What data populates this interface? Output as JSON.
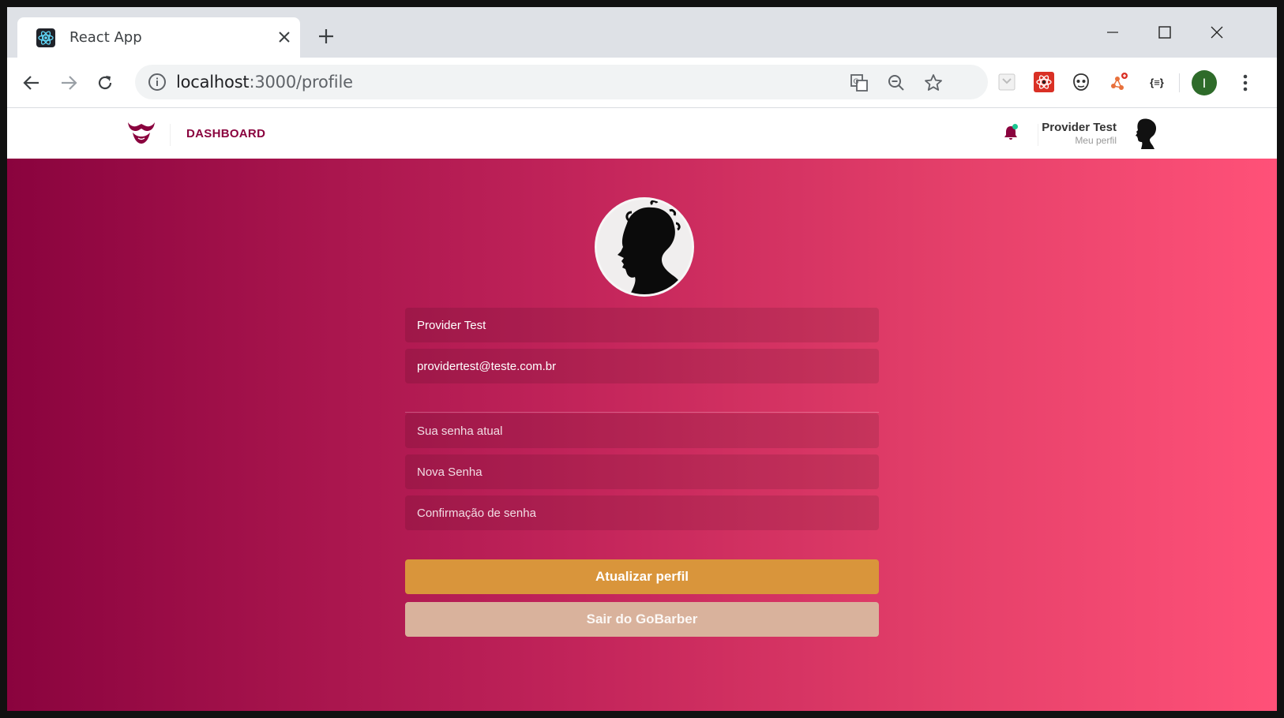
{
  "browser": {
    "tab_title": "React App",
    "url_host": "localhost",
    "url_path": ":3000/profile",
    "profile_initial": "I",
    "extensions": [
      "save-to-pocket-icon",
      "react-devtools-icon",
      "wappalyzer-icon",
      "network-graph-icon",
      "json-formatter-icon"
    ],
    "extension_label_json": "{≡}"
  },
  "header": {
    "nav_label": "DASHBOARD",
    "user_name": "Provider Test",
    "profile_link": "Meu perfil"
  },
  "form": {
    "name_value": "Provider Test",
    "email_value": "providertest@teste.com.br",
    "old_password_placeholder": "Sua senha atual",
    "new_password_placeholder": "Nova Senha",
    "confirm_password_placeholder": "Confirmação de senha",
    "submit_label": "Atualizar perfil",
    "logout_label": "Sair do GoBarber"
  },
  "colors": {
    "brand": "#8a033e",
    "gradient_start": "#8a033e",
    "gradient_end": "#ff5178",
    "submit_button": "#d9953b",
    "logout_button": "#d9b29c",
    "notification_dot": "#19c790"
  }
}
